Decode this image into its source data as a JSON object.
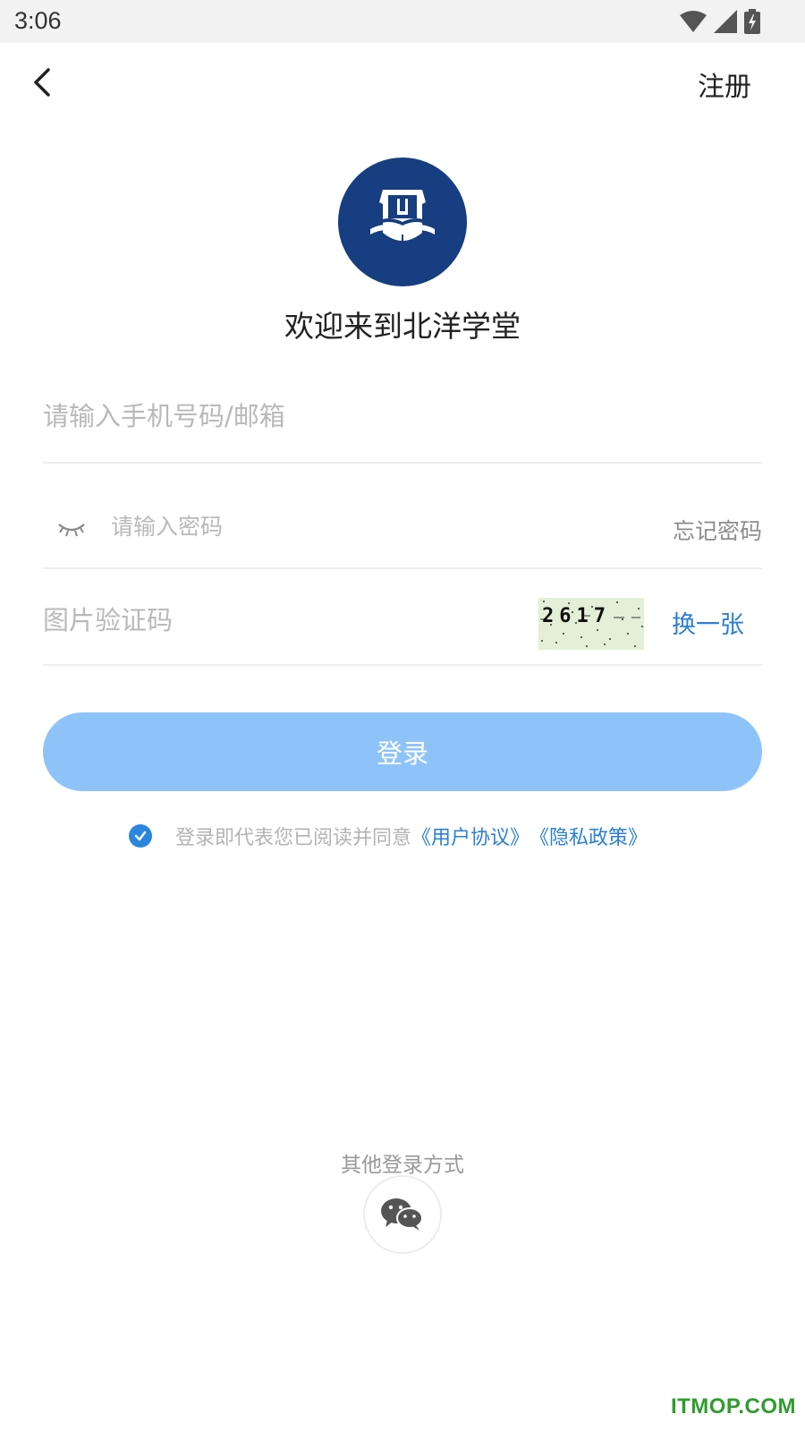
{
  "status_bar": {
    "time": "3:06",
    "icons": [
      "wifi-icon",
      "cell-signal-icon",
      "battery-charging-icon"
    ]
  },
  "header": {
    "back_icon": "chevron-left-icon",
    "register_label": "注册"
  },
  "logo": {
    "icon": "school-shield-book-logo",
    "color": "#163e80"
  },
  "welcome_text": "欢迎来到北洋学堂",
  "form": {
    "phone_placeholder": "请输入手机号码/邮箱",
    "password_placeholder": "请输入密码",
    "password_visibility_icon": "eye-closed-icon",
    "forgot_password_label": "忘记密码",
    "captcha_placeholder": "图片验证码",
    "captcha_code": "2617",
    "refresh_captcha_label": "换一张"
  },
  "login_button_label": "登录",
  "agreement": {
    "checked": true,
    "text": "登录即代表您已阅读并同意",
    "user_agreement": "《用户协议》",
    "privacy_policy": "《隐私政策》"
  },
  "other_login": {
    "label": "其他登录方式",
    "wechat_icon": "wechat-icon"
  },
  "watermark": "ITMOP.COM",
  "colors": {
    "accent": "#2a7fd6",
    "button": "#8ec3fa",
    "brand": "#163e80"
  }
}
